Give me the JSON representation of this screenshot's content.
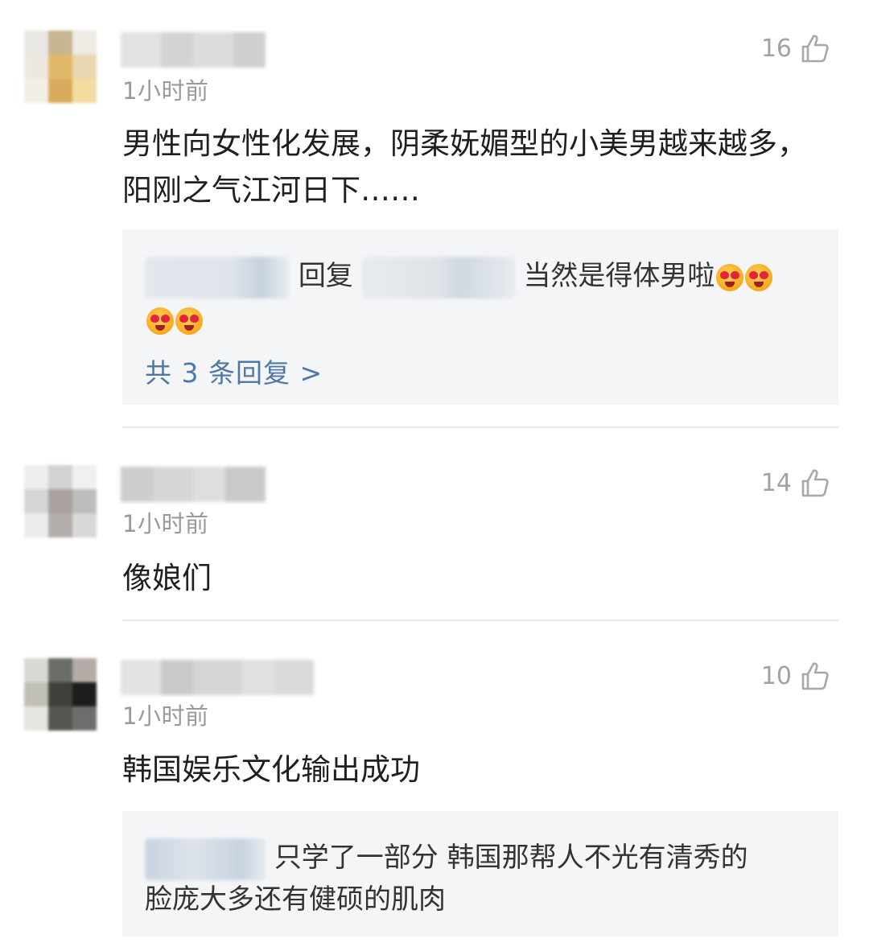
{
  "comments": [
    {
      "time": "1小时前",
      "likes": "16",
      "text": "男性向女性化发展，阴柔妩媚型的小美男越来越多，阳刚之气江河日下……",
      "reply": {
        "verb": "回复",
        "text": "当然是得体男啦",
        "more": "共 3 条回复 >"
      }
    },
    {
      "time": "1小时前",
      "likes": "14",
      "text": "像娘们"
    },
    {
      "time": "1小时前",
      "likes": "10",
      "text": "韩国娱乐文化输出成功",
      "reply": {
        "text_line1": "只学了一部分 韩国那帮人不光有清秀的",
        "text_line2": "脸庞大多还有健硕的肌肉"
      }
    }
  ],
  "icons": {
    "like": "thumbs-up-outline-icon",
    "reaction": "heart-eyes-tongue-emoji"
  },
  "colors": {
    "link": "#4f78a8",
    "meta": "#9a9a9a",
    "reply_bg": "#f4f5f7"
  }
}
